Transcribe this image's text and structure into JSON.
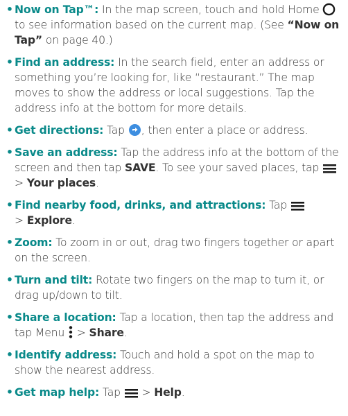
{
  "items": [
    {
      "lead": "Now on Tap™:",
      "t1": " In the map screen, touch and hold Home ",
      "icon": "home-circle-icon",
      "t2": " to see information based on the current map. (See ",
      "ref": "“Now on Tap”",
      "t3": " on page 40.)"
    },
    {
      "lead": "Find an address:",
      "t1": " In the search field, enter an address or something you’re looking for, like “restaurant.” The map moves to show the address or local suggestions. Tap the address info at the bottom for more details."
    },
    {
      "lead": "Get directions:",
      "t1": " Tap ",
      "icon": "directions-icon",
      "t2": ", then enter a place or address."
    },
    {
      "lead": "Save an address:",
      "t1": " Tap the address info at the bottom of the screen and then tap ",
      "b1": "SAVE",
      "t2": ". To see your saved places, tap ",
      "icon": "menu-icon",
      "t3": " > ",
      "b2": "Your places",
      "t4": "."
    },
    {
      "lead": "Find nearby food, drinks, and attractions:",
      "t1": " Tap ",
      "icon": "menu-icon",
      "t2": " > ",
      "b1": "Explore",
      "t3": "."
    },
    {
      "lead": "Zoom:",
      "t1": " To zoom in or out, drag two fingers together or apart on the screen."
    },
    {
      "lead": "Turn and tilt:",
      "t1": " Rotate two fingers on the map to turn it, or drag up/down to tilt."
    },
    {
      "lead": "Share a location:",
      "t1": " Tap a location, then tap the address and tap Menu ",
      "icon": "more-vertical-icon",
      "t2": " > ",
      "b1": "Share",
      "t3": "."
    },
    {
      "lead": "Identify address:",
      "t1": " Touch and hold a spot on the map to show the nearest address."
    },
    {
      "lead": "Get map help:",
      "t1": " Tap ",
      "icon": "menu-icon",
      "t2": " > ",
      "b1": "Help",
      "t3": "."
    }
  ],
  "bullet": "•",
  "colors": {
    "accent": "#0a8a8a",
    "text": "#333333",
    "directions_icon": "#3d8ee0"
  }
}
